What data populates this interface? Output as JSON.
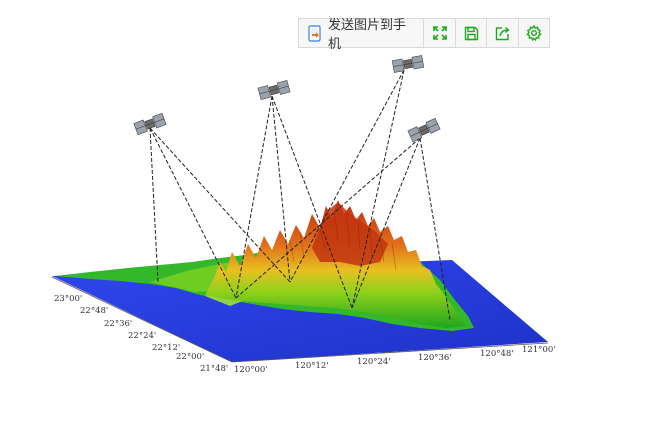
{
  "toolbar": {
    "send_to_phone_label": "发送图片到手机",
    "icons": [
      "phone-send-icon",
      "fullscreen-icon",
      "save-icon",
      "share-icon",
      "settings-icon"
    ],
    "accent_color": "#1aad19"
  },
  "figure": {
    "latitude_ticks": [
      "23°00'",
      "22°48'",
      "22°36'",
      "22°24'",
      "22°12'",
      "22°00'",
      "21°48'"
    ],
    "longitude_ticks": [
      "120°00'",
      "120°12'",
      "120°24'",
      "120°36'",
      "120°48'",
      "121°00'"
    ],
    "satellite_count": 4,
    "colors": {
      "sea": "#2b40e6",
      "lowland": "#2db82d",
      "highland": "#c93a10"
    }
  }
}
